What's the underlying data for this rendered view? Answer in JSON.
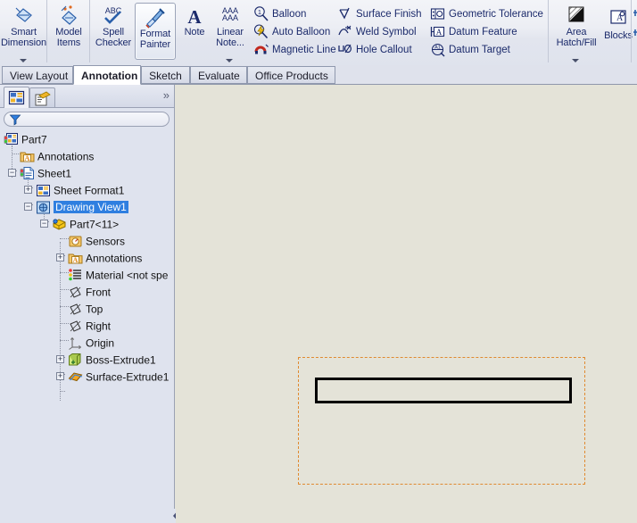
{
  "ribbon": {
    "groups": [
      {
        "name": "dimension-group",
        "commands": [
          {
            "label_line1": "Smart",
            "label_line2": "Dimension",
            "icon": "smart-dimension-icon",
            "dropdown": true
          },
          {
            "label_line1": "Model",
            "label_line2": "Items",
            "icon": "model-items-icon",
            "dropdown": false
          }
        ]
      },
      {
        "name": "annotation-group",
        "commands": [
          {
            "label_line1": "Spell",
            "label_line2": "Checker",
            "icon": "spell-checker-icon",
            "dropdown": false
          },
          {
            "label_line1": "Format",
            "label_line2": "Painter",
            "icon": "format-painter-icon",
            "dropdown": false,
            "selected": true
          },
          {
            "label_line1": "Note",
            "label_line2": "",
            "icon": "note-icon",
            "dropdown": false
          },
          {
            "label_line1": "Linear",
            "label_line2": "Note...",
            "icon": "linear-note-icon",
            "dropdown": true
          }
        ],
        "small_commands": [
          {
            "label": "Balloon",
            "icon": "balloon-icon"
          },
          {
            "label": "Auto Balloon",
            "icon": "auto-balloon-icon"
          },
          {
            "label": "Magnetic Line",
            "icon": "magnetic-line-icon"
          },
          {
            "label": "Surface Finish",
            "icon": "surface-finish-icon"
          },
          {
            "label": "Weld Symbol",
            "icon": "weld-symbol-icon"
          },
          {
            "label": "Hole Callout",
            "icon": "hole-callout-icon"
          },
          {
            "label": "Geometric Tolerance",
            "icon": "geometric-tolerance-icon"
          },
          {
            "label": "Datum Feature",
            "icon": "datum-feature-icon"
          },
          {
            "label": "Datum Target",
            "icon": "datum-target-icon"
          }
        ]
      },
      {
        "name": "hatch-blocks-group",
        "commands": [
          {
            "label_line1": "Area",
            "label_line2": "Hatch/Fill",
            "icon": "area-hatch-fill-icon",
            "dropdown": true
          },
          {
            "label_line1": "Blocks",
            "label_line2": "",
            "icon": "blocks-icon",
            "dropdown": false
          }
        ]
      }
    ]
  },
  "tabs": [
    {
      "label": "View Layout",
      "active": false
    },
    {
      "label": "Annotation",
      "active": true
    },
    {
      "label": "Sketch",
      "active": false
    },
    {
      "label": "Evaluate",
      "active": false
    },
    {
      "label": "Office Products",
      "active": false
    }
  ],
  "left_panel": {
    "tabs": [
      {
        "name": "feature-manager-tab",
        "icon": "feature-manager-icon",
        "active": true
      },
      {
        "name": "property-manager-tab",
        "icon": "property-manager-icon",
        "active": false
      }
    ],
    "expand_chevron": "»",
    "filter": {
      "placeholder": "",
      "icon": "filter-icon"
    },
    "tree": [
      {
        "label": "Part7",
        "icon": "part-document-icon",
        "depth": 0,
        "expander": "none",
        "selected": false
      },
      {
        "label": "Annotations",
        "icon": "annotations-folder-icon",
        "depth": 1,
        "expander": "none",
        "selected": false
      },
      {
        "label": "Sheet1",
        "icon": "sheet-icon",
        "depth": 1,
        "expander": "minus",
        "selected": false
      },
      {
        "label": "Sheet Format1",
        "icon": "sheet-format-icon",
        "depth": 2,
        "expander": "plus",
        "selected": false
      },
      {
        "label": "Drawing View1",
        "icon": "drawing-view-icon",
        "depth": 2,
        "expander": "minus",
        "selected": true
      },
      {
        "label": "Part7<11>",
        "icon": "part-ref-icon",
        "depth": 3,
        "expander": "minus",
        "selected": false
      },
      {
        "label": "Sensors",
        "icon": "sensors-icon",
        "depth": 4,
        "expander": "none",
        "selected": false
      },
      {
        "label": "Annotations",
        "icon": "annotations-folder-icon",
        "depth": 4,
        "expander": "plus",
        "selected": false
      },
      {
        "label": "Material <not spe",
        "icon": "material-icon",
        "depth": 4,
        "expander": "none",
        "selected": false
      },
      {
        "label": "Front",
        "icon": "plane-icon",
        "depth": 4,
        "expander": "none",
        "selected": false
      },
      {
        "label": "Top",
        "icon": "plane-icon",
        "depth": 4,
        "expander": "none",
        "selected": false
      },
      {
        "label": "Right",
        "icon": "plane-icon",
        "depth": 4,
        "expander": "none",
        "selected": false
      },
      {
        "label": "Origin",
        "icon": "origin-icon",
        "depth": 4,
        "expander": "none",
        "selected": false
      },
      {
        "label": "Boss-Extrude1",
        "icon": "boss-extrude-icon",
        "depth": 4,
        "expander": "plus",
        "selected": false
      },
      {
        "label": "Surface-Extrude1",
        "icon": "surface-extrude-icon",
        "depth": 4,
        "expander": "plus",
        "selected": false
      }
    ]
  },
  "canvas": {
    "background_color": "#e4e3d8",
    "view_boundary": {
      "name": "drawing-view-boundary",
      "color": "#e08a30",
      "style": "dashed"
    },
    "part_outline": {
      "name": "part-outline-rectangle",
      "color": "#000000"
    }
  },
  "colors": {
    "selection_blue": "#2f7fe0",
    "ribbon_text": "#1b2a6b",
    "canvas": "#e4e3d8",
    "view_border": "#e08a30"
  }
}
